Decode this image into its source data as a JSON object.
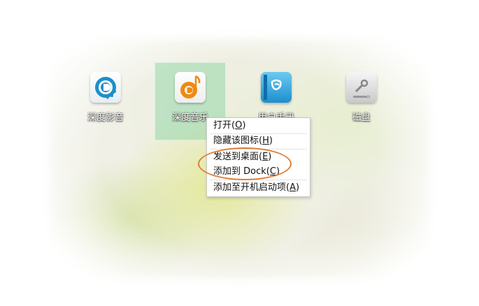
{
  "desktop": {
    "apps": [
      {
        "label": "深度影音",
        "icon": "deepin-movie-icon"
      },
      {
        "label": "深度音乐",
        "icon": "deepin-music-icon"
      },
      {
        "label": "用户手册",
        "icon": "user-manual-icon"
      },
      {
        "label": "磁盘",
        "icon": "disk-utility-icon"
      }
    ]
  },
  "context_menu": {
    "items": [
      {
        "text": "打开(",
        "key": "O",
        "tail": ")"
      },
      {
        "text": "隐藏该图标(",
        "key": "H",
        "tail": ")"
      },
      {
        "text": "发送到桌面(",
        "key": "E",
        "tail": ")"
      },
      {
        "text": "添加到 Dock(",
        "key": "C",
        "tail": ")"
      },
      {
        "text": "添加至开机启动项(",
        "key": "A",
        "tail": ")"
      }
    ]
  },
  "colors": {
    "highlight_ellipse": "#e07d36",
    "selection": "#96d7aa"
  }
}
